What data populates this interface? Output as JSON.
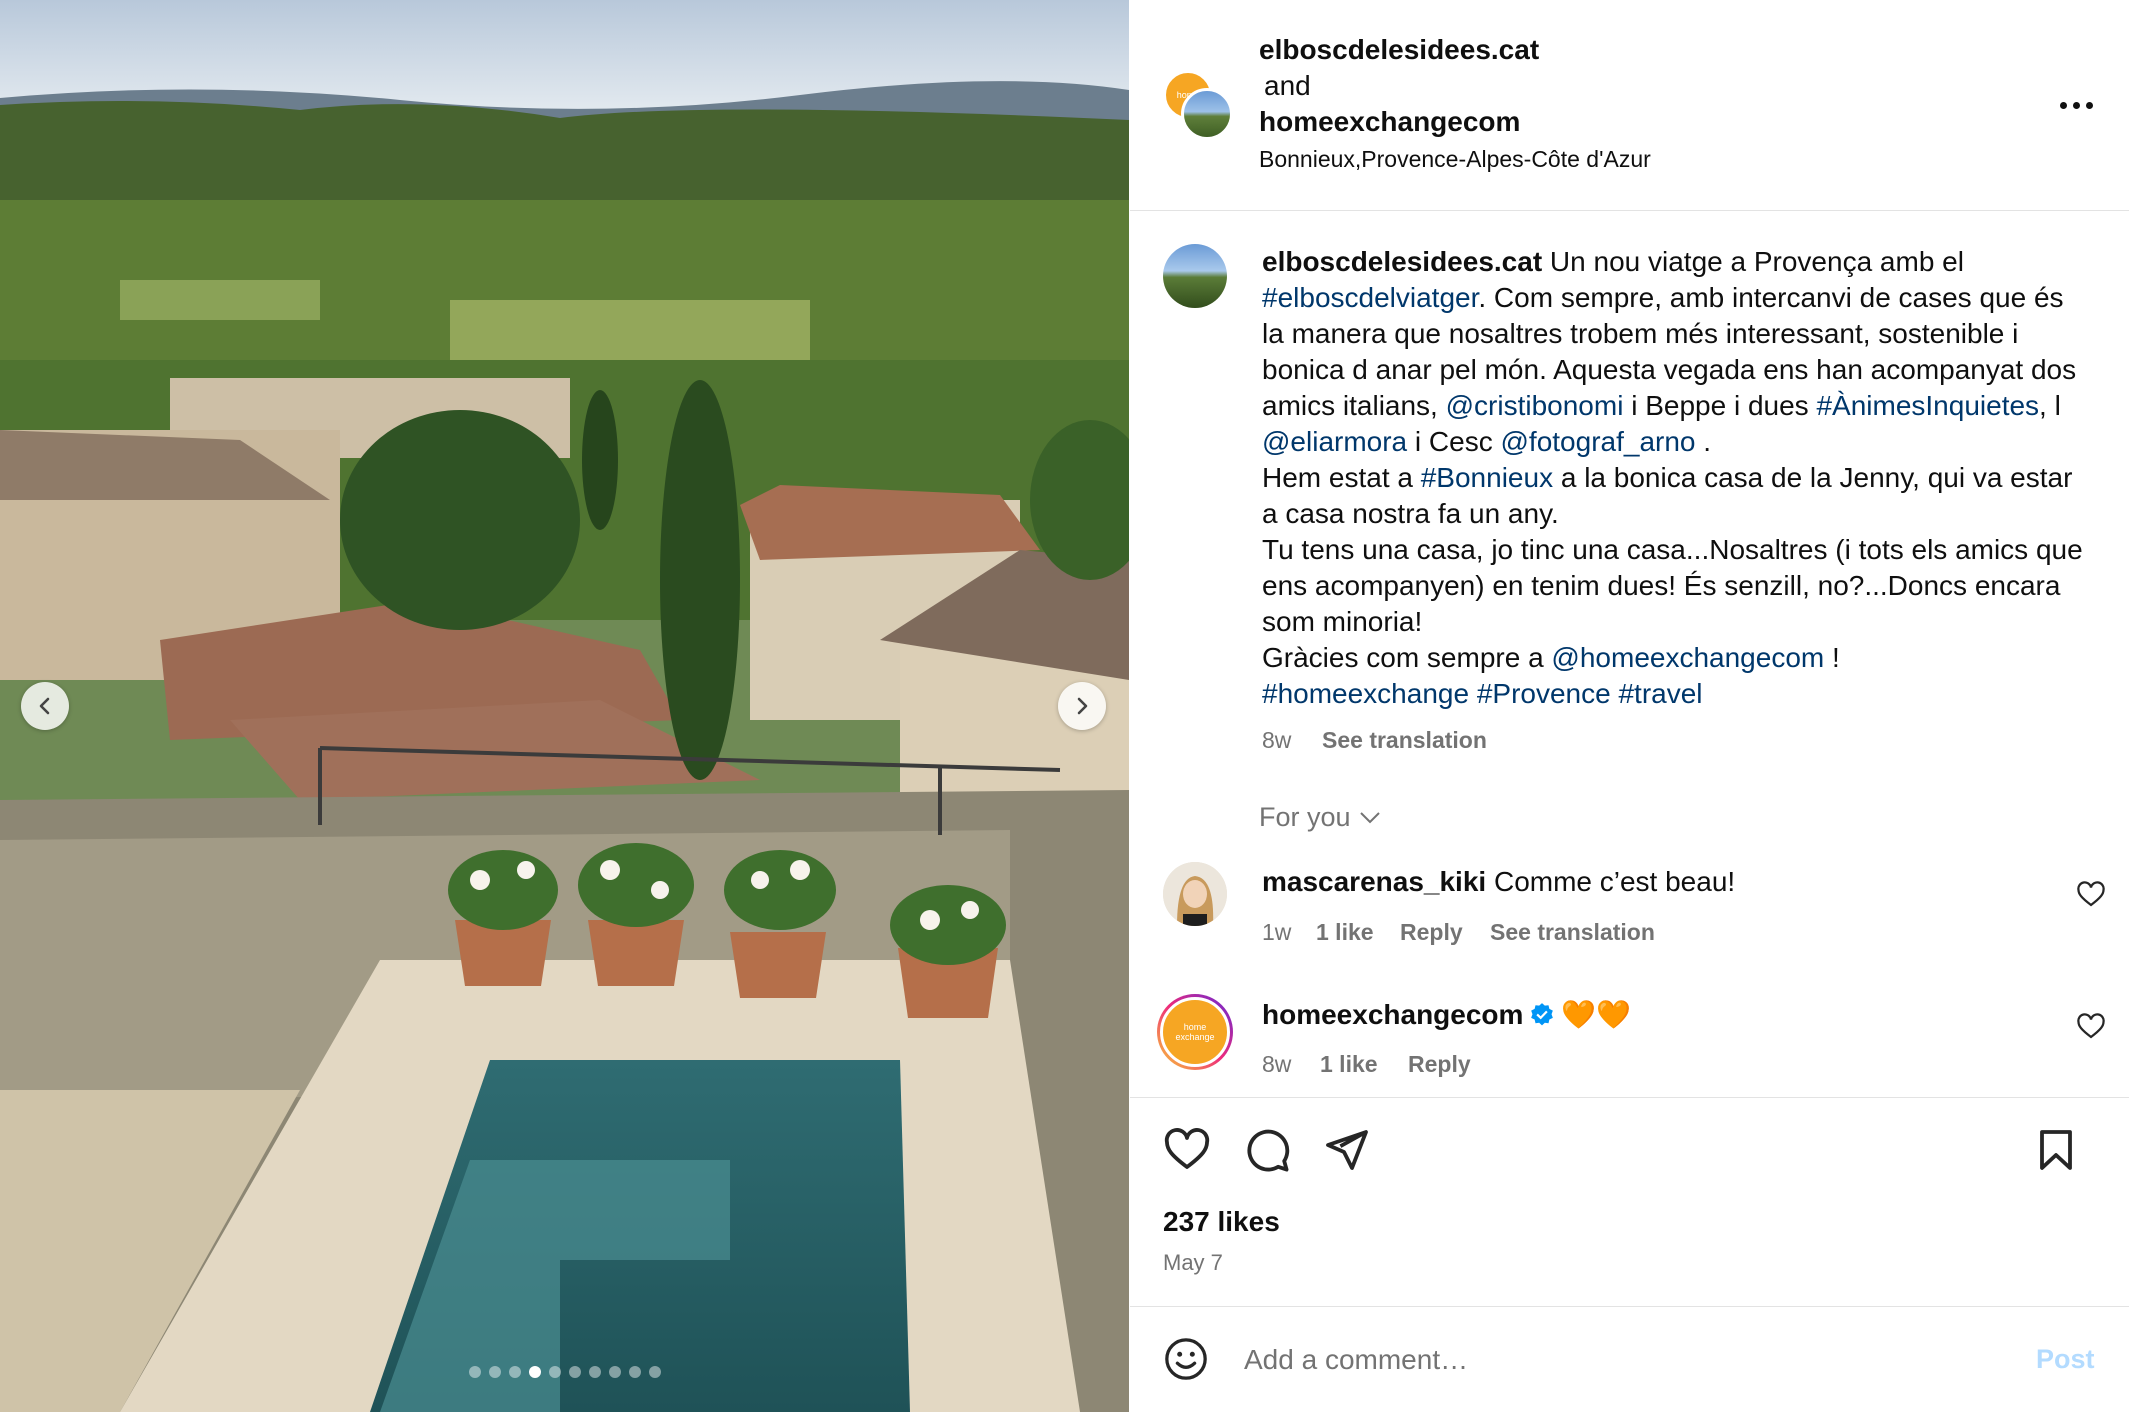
{
  "post": {
    "carousel": {
      "slide_count": 10,
      "active_index": 3
    },
    "header": {
      "author_1": "elboscdelesidees.cat",
      "connector": "and",
      "author_2": "homeexchangecom",
      "location": "Bonnieux,Provence-Alpes-Côte d'Azur",
      "avatar_1_text": "home"
    },
    "caption": {
      "author": "elboscdelesidees.cat",
      "t1": " Un nou viatge a Provença amb el ",
      "h_elboscdelviatger": "#elboscdelviatger",
      "t2": ". Com sempre, amb intercanvi de cases que és la manera que nosaltres trobem més interessant, sostenible i bonica d anar pel món. Aquesta vegada ens han acompanyat dos amics italians, ",
      "m_cristibonomi": "@cristibonomi",
      "t3": " i Beppe i dues ",
      "h_animesinquietes": "#ÀnimesInquietes",
      "t4": ", l ",
      "m_eliarmora": "@eliarmora",
      "t5": " i Cesc ",
      "m_fotograf_arno": "@fotograf_arno",
      "t6": " .",
      "t7": "Hem estat a ",
      "h_bonnieux": "#Bonnieux",
      "t8": " a la bonica casa de la Jenny, qui va estar a casa nostra fa un any.",
      "t9": "Tu tens una casa, jo tinc una casa...Nosaltres (i tots els amics que ens acompanyen) en tenim dues! És senzill, no?...Doncs encara som minoria!",
      "t10": "Gràcies com sempre a ",
      "m_homeexchangecom": "@homeexchangecom",
      "t11": " !",
      "h_homeexchange": "#homeexchange",
      "h_provence": "#Provence",
      "h_travel": "#travel",
      "age": "8w",
      "see_translation": "See translation"
    },
    "for_you": "For you",
    "comments": [
      {
        "username": "mascarenas_kiki",
        "text": "Comme c’est beau!",
        "age": "1w",
        "likes": "1 like",
        "reply": "Reply",
        "see_translation": "See translation"
      },
      {
        "username": "homeexchangecom",
        "text": "🧡🧡",
        "age": "8w",
        "likes": "1 like",
        "reply": "Reply",
        "avatar_text": "home exchange"
      }
    ],
    "likes": "237 likes",
    "date": "May 7",
    "comment_box": {
      "placeholder": "Add a comment…",
      "post_label": "Post"
    },
    "colors": {
      "link": "#00376b",
      "muted": "#737373",
      "post_disabled": "#b3dbff",
      "brand_orange": "#f6a623",
      "verified": "#0095f6"
    }
  }
}
